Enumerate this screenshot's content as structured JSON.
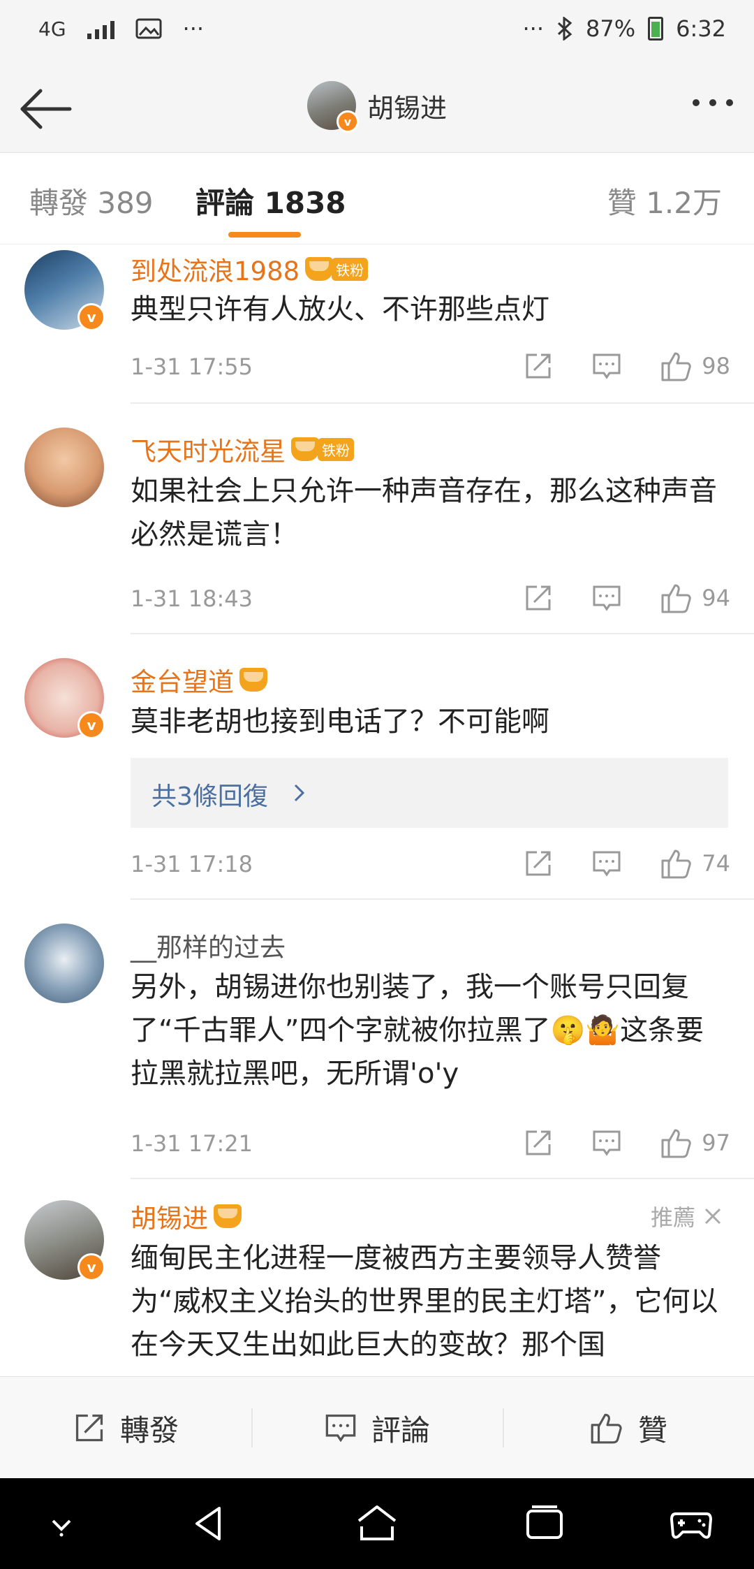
{
  "status_bar": {
    "network": "4G",
    "dots_left": "···",
    "dots_right": "···",
    "battery": "87%",
    "time": "6:32"
  },
  "header": {
    "title": "胡锡进"
  },
  "tabs": {
    "repost": "轉發 389",
    "comment": "評論 1838",
    "like": "贊 1.2万"
  },
  "comments": [
    {
      "username": "到处流浪1988",
      "fan_badge": "铁粉",
      "text": "典型只许有人放火、不许那些点灯",
      "time": "1-31 17:55",
      "likes": "98"
    },
    {
      "username": "飞天时光流星",
      "fan_badge": "铁粉",
      "text": "如果社会上只允许一种声音存在，那么这种声音必然是谎言！",
      "time": "1-31 18:43",
      "likes": "94"
    },
    {
      "username": "金台望道",
      "text": "莫非老胡也接到电话了？不可能啊",
      "replies": "共3條回復",
      "time": "1-31 17:18",
      "likes": "74"
    },
    {
      "username": "__那样的过去",
      "text": "另外，胡锡进你也别装了，我一个账号只回复了“千古罪人”四个字就被你拉黑了🤫🤷这条要拉黑就拉黑吧，无所谓'o'y",
      "time": "1-31 17:21",
      "likes": "97"
    },
    {
      "username": "胡锡进",
      "recommend": "推薦",
      "text": "缅甸民主化进程一度被西方主要领导人赞誉为“威权主义抬头的世界里的民主灯塔”，它何以在今天又生出如此巨大的变故？那个国"
    }
  ],
  "bottom_bar": {
    "repost": "轉發",
    "comment": "評論",
    "like": "贊"
  },
  "colors": {
    "accent": "#f7881b",
    "username": "#e8741a",
    "link": "#4a6fa0"
  }
}
